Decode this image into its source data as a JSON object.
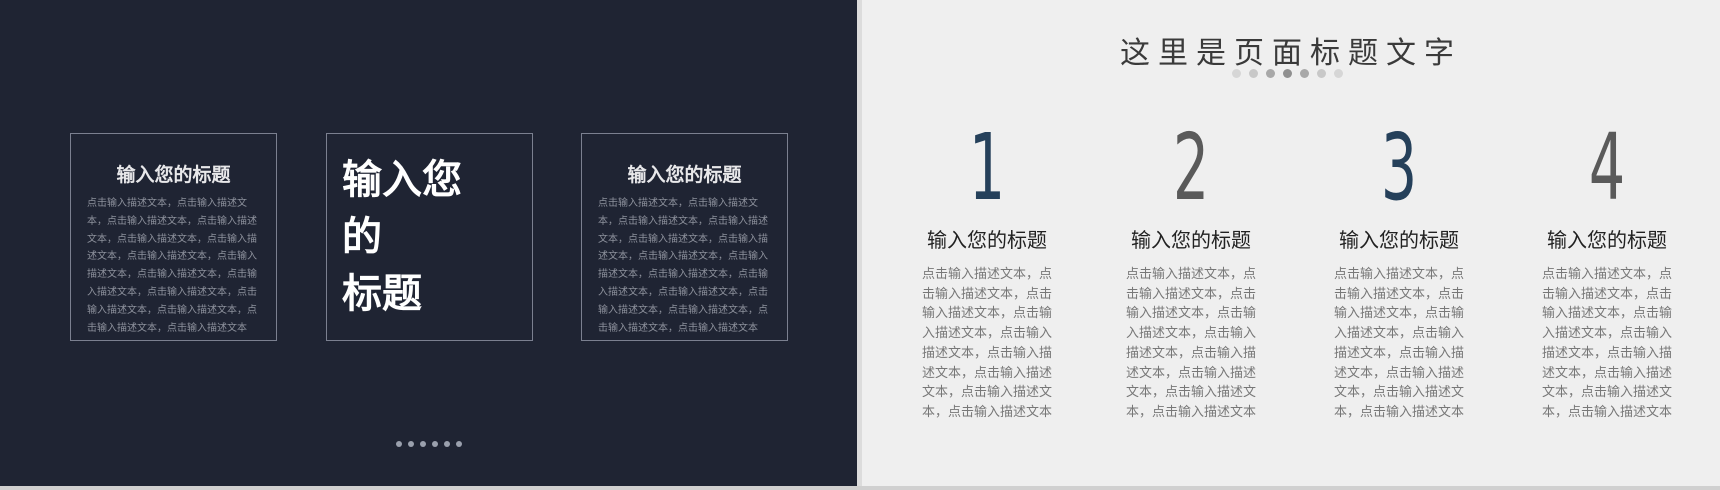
{
  "left_slide": {
    "card_left": {
      "title": "输入您的标题",
      "body": "点击输入描述文本，点击输入描述文本，点击输入描述文本，点击输入描述文本，点击输入描述文本，点击输入描述文本，点击输入描述文本，点击输入描述文本，点击输入描述文本，点击输入描述文本，点击输入描述文本，点击输入描述文本，点击输入描述文本，点击输入描述文本，点击输入描述文本"
    },
    "card_middle": {
      "title": "输入您\n的\n标题"
    },
    "card_right": {
      "title": "输入您的标题",
      "body": "点击输入描述文本，点击输入描述文本，点击输入描述文本，点击输入描述文本，点击输入描述文本，点击输入描述文本，点击输入描述文本，点击输入描述文本，点击输入描述文本，点击输入描述文本，点击输入描述文本，点击输入描述文本，点击输入描述文本，点击输入描述文本，点击输入描述文本"
    }
  },
  "right_slide": {
    "title": "这里是页面标题文字",
    "columns": [
      {
        "number": "1",
        "color": "#25405a",
        "title": "输入您的标题",
        "body": "点击输入描述文本，点击输入描述文本，点击输入描述文本，点击输入描述文本，点击输入描述文本，点击输入描述文本，点击输入描述文本，点击输入描述文本，点击输入描述文本"
      },
      {
        "number": "2",
        "color": "#5a5a5a",
        "title": "输入您的标题",
        "body": "点击输入描述文本，点击输入描述文本，点击输入描述文本，点击输入描述文本，点击输入描述文本，点击输入描述文本，点击输入描述文本，点击输入描述文本，点击输入描述文本"
      },
      {
        "number": "3",
        "color": "#25405a",
        "title": "输入您的标题",
        "body": "点击输入描述文本，点击输入描述文本，点击输入描述文本，点击输入描述文本，点击输入描述文本，点击输入描述文本，点击输入描述文本，点击输入描述文本，点击输入描述文本"
      },
      {
        "number": "4",
        "color": "#5a5a5a",
        "title": "输入您的标题",
        "body": "点击输入描述文本，点击输入描述文本，点击输入描述文本，点击输入描述文本，点击输入描述文本，点击输入描述文本，点击输入描述文本，点击输入描述文本，点击输入描述文本"
      }
    ]
  },
  "colors": {
    "dark_bg": "#1f2433",
    "light_bg": "#efefef",
    "accent_blue": "#25405a",
    "accent_gray": "#5a5a5a"
  }
}
